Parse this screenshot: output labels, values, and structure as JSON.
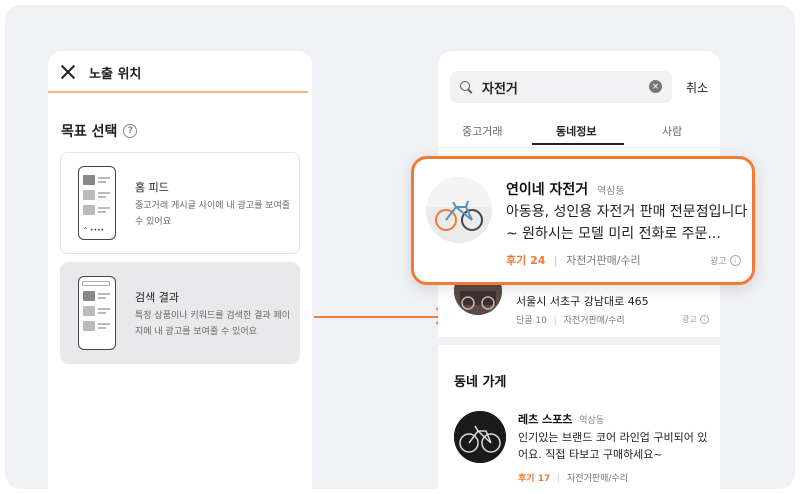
{
  "left_panel": {
    "title": "노출 위치",
    "section_title": "목표 선택",
    "help_icon": "?",
    "options": [
      {
        "title": "홈 피드",
        "desc": "중고거래 게시글 사이에 내 광고를 보여줄 수 있어요",
        "selected": false
      },
      {
        "title": "검색 결과",
        "desc": "특정 상품이나 키워드를 검색한 결과 페이지에 내 광고를 보여줄 수 있어요",
        "selected": true
      }
    ]
  },
  "right_panel": {
    "search": {
      "query": "자전거",
      "clear_icon": "×",
      "cancel_label": "취소"
    },
    "tabs": [
      "중고거래",
      "동네정보",
      "사람"
    ],
    "active_tab": "동네정보",
    "featured": {
      "name": "연이네 자전거",
      "location": "역삼동",
      "desc": "아동용, 성인용 자전거 판매 전문점입니다~ 원하시는 모델 미리 전화로 주문...",
      "reviews_label": "후기 24",
      "category": "자전거판매/수리",
      "ad_label": "광고",
      "info_icon": "i"
    },
    "second": {
      "address": "서울시 서초구 강남대로 465",
      "regulars_label": "단골 10",
      "category": "자전거판매/수리",
      "ad_label": "광고",
      "info_icon": "i"
    },
    "nearby": {
      "heading": "동네 가게",
      "name": "레츠 스포츠",
      "location": "역삼동",
      "desc": "인기있는 브랜드 코어 라인업 구비되어 있어요. 직접 타보고 구매하세요~",
      "reviews_label": "후기 17",
      "category": "자전거판매/수리"
    }
  },
  "colors": {
    "accent": "#f07b35",
    "background": "#f0f1f4"
  }
}
